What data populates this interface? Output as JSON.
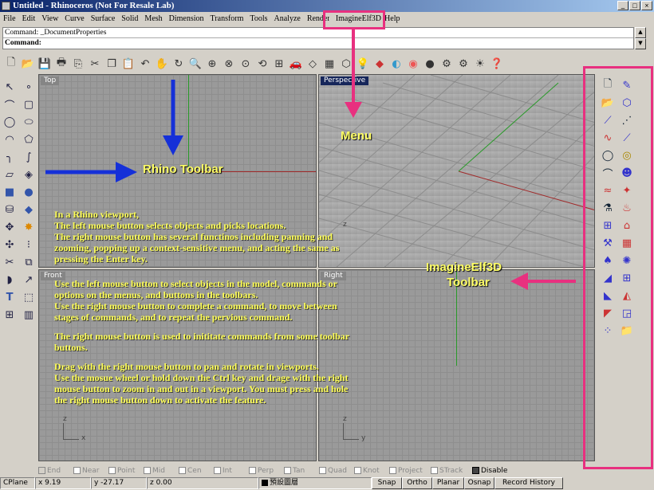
{
  "window": {
    "title": "Untitled - Rhinoceros (Not For Resale Lab)",
    "buttons": [
      "_",
      "□",
      "×"
    ]
  },
  "menu": [
    "File",
    "Edit",
    "View",
    "Curve",
    "Surface",
    "Solid",
    "Mesh",
    "Dimension",
    "Transform",
    "Tools",
    "Analyze",
    "Render",
    "ImagineElf3D",
    "Help"
  ],
  "command": {
    "history": "Command: _DocumentProperties",
    "prompt": "Command:"
  },
  "viewports": {
    "top": "Top",
    "perspective": "Perspective",
    "front": "Front",
    "right": "Right",
    "axis_x": "x",
    "axis_y": "y",
    "axis_z": "z"
  },
  "annotations": {
    "rhino_toolbar": "Rhino Toolbar",
    "menu": "Menu",
    "imagine_toolbar_1": "ImagineElf3D",
    "imagine_toolbar_2": "Toolbar"
  },
  "paragraph1": [
    "In a Rhino viewport,",
    "The left mouse button selects objects and picks locations.",
    "The right mouse button has several functinos including panning and",
    "zooming, popping up a context-sensitive menu, and acting the same as",
    "pressing the Enter key."
  ],
  "paragraph2": [
    "Use the left mouse button to select objects in the model, commands or",
    "options on the menus, and buttons in the toolbars.",
    "Use the right mouse button to  complete a command, to move between",
    "stages of commands, and to repeat the pervious command.",
    "",
    "The right mouse button is used to inititate commands from some toolbar",
    "buttons.",
    "",
    "Drag with the right mouse button to pan and rotate in viewports.",
    "Use the mosue wheel or hold down the Ctrl key and drage with the right",
    "mouse button to zoom in and out in a viewport. You must press and hole",
    "the right mouse button down to activate the feature."
  ],
  "snaps": [
    {
      "label": "End",
      "checked": true
    },
    {
      "label": "Near",
      "checked": false
    },
    {
      "label": "Point",
      "checked": false
    },
    {
      "label": "Mid",
      "checked": false
    },
    {
      "label": "Cen",
      "checked": false
    },
    {
      "label": "Int",
      "checked": false
    },
    {
      "label": "Perp",
      "checked": false
    },
    {
      "label": "Tan",
      "checked": false
    },
    {
      "label": "Quad",
      "checked": false
    },
    {
      "label": "Knot",
      "checked": false
    },
    {
      "label": "Project",
      "checked": false
    },
    {
      "label": "STrack",
      "checked": false
    },
    {
      "label": "Disable",
      "checked": true
    }
  ],
  "status": {
    "cplane": "CPlane",
    "x": "x 9.19",
    "y": "y -27.17",
    "z": "z 0.00",
    "layer": "預設圖層",
    "snap": "Snap",
    "ortho": "Ortho",
    "planar": "Planar",
    "osnap": "Osnap",
    "record": "Record History"
  },
  "colors": {
    "annotation_box": "#e8307f",
    "blue_arrow": "#1530d8",
    "annotation_text": "#ffff66"
  },
  "toolbar_icons": [
    "new-icon",
    "open-icon",
    "save-icon",
    "print-icon",
    "import-icon",
    "cut-icon",
    "copy-icon",
    "paste-icon",
    "undo-icon",
    "pan-icon",
    "rotate-icon",
    "zoom-icon",
    "zoom-window-icon",
    "zoom-extents-icon",
    "zoom-selected-icon",
    "undo-view-icon",
    "viewports-icon",
    "car-icon",
    "cplane-icon",
    "grid-icon",
    "mirror-icon",
    "light-icon",
    "render-icon",
    "shade-icon",
    "color-icon",
    "sphere-icon",
    "plugin-icon",
    "gear-icon",
    "light2-icon",
    "help-icon"
  ],
  "left_icons": [
    "select-icon",
    "point-icon",
    "curve-icon",
    "rectangle-icon",
    "circle-icon",
    "ellipse-icon",
    "arc-icon",
    "polygon-icon",
    "fillet-icon",
    "curve2-icon",
    "surface-icon",
    "surface2-icon",
    "solid-icon",
    "solid2-icon",
    "extrude-icon",
    "cylinder-icon",
    "boolean-icon",
    "explode-icon",
    "move-icon",
    "array-icon",
    "trim-icon",
    "group-icon",
    "mesh-icon",
    "dim-icon",
    "text-icon",
    "block-icon",
    "analyze-icon",
    "render-icon"
  ],
  "right_icons": [
    "elf-new-icon",
    "elf-shape-icon",
    "elf-open-icon",
    "elf-bottle-icon",
    "elf-stroke-icon",
    "elf-rope-icon",
    "elf-curve-icon",
    "elf-blade-icon",
    "elf-circle-icon",
    "elf-ring-icon",
    "elf-hook-icon",
    "elf-face-icon",
    "elf-wave-icon",
    "elf-gem-icon",
    "elf-flask-icon",
    "elf-shoe-icon",
    "elf-grid-icon",
    "elf-boot-icon",
    "elf-hammer-icon",
    "elf-palette-icon",
    "elf-bolt-icon",
    "elf-star-icon",
    "elf-fin-icon",
    "elf-fish-icon",
    "elf-leaf-icon",
    "elf-feather-icon",
    "elf-flag-icon",
    "elf-tile-icon",
    "elf-bead-icon",
    "elf-folder-icon"
  ]
}
